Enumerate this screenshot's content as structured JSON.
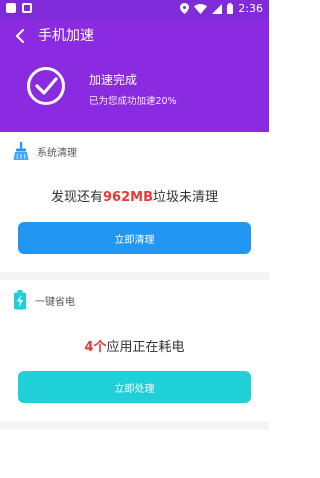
{
  "status_bar": {
    "time": "2:36"
  },
  "header": {
    "title": "手机加速",
    "done_title": "加速完成",
    "done_subtitle": "已为您成功加速20%"
  },
  "clean_section": {
    "title": "系统清理",
    "message_prefix": "发现还有",
    "message_highlight": "962MB",
    "message_suffix": "垃圾未清理",
    "button_label": "立即清理"
  },
  "power_section": {
    "title": "一键省电",
    "message_highlight": "4个",
    "message_suffix": "应用正在耗电",
    "button_label": "立即处理"
  },
  "colors": {
    "header_bg": "#8a2be2",
    "clean_button": "#2196f3",
    "power_button": "#1fd0d8",
    "highlight": "#e53935"
  }
}
